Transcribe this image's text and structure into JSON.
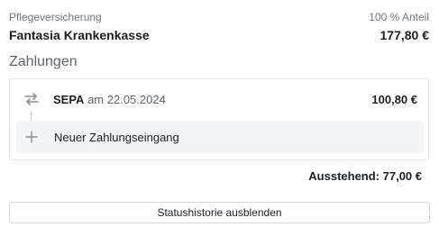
{
  "insurance": {
    "type_label": "Pflegeversicherung",
    "share_label": "100 % Anteil",
    "name": "Fantasia Krankenkasse",
    "amount": "177,80 €"
  },
  "payments": {
    "section_title": "Zahlungen",
    "items": [
      {
        "method": "SEPA",
        "date_prefix": "am",
        "date": "22.05.2024",
        "amount": "100,80 €",
        "icon": "transfer-arrows-icon"
      }
    ],
    "add_label": "Neuer Zahlungseingang",
    "add_icon": "plus-icon"
  },
  "outstanding": {
    "text": "Ausstehend: 77,00 €"
  },
  "history_button": {
    "label": "Statushistorie ausblenden"
  },
  "colors": {
    "text": "#1b1f23",
    "muted": "#6e747b",
    "border": "#e3e6ea",
    "row_bg": "#f3f4f6",
    "icon": "#8a9098"
  }
}
